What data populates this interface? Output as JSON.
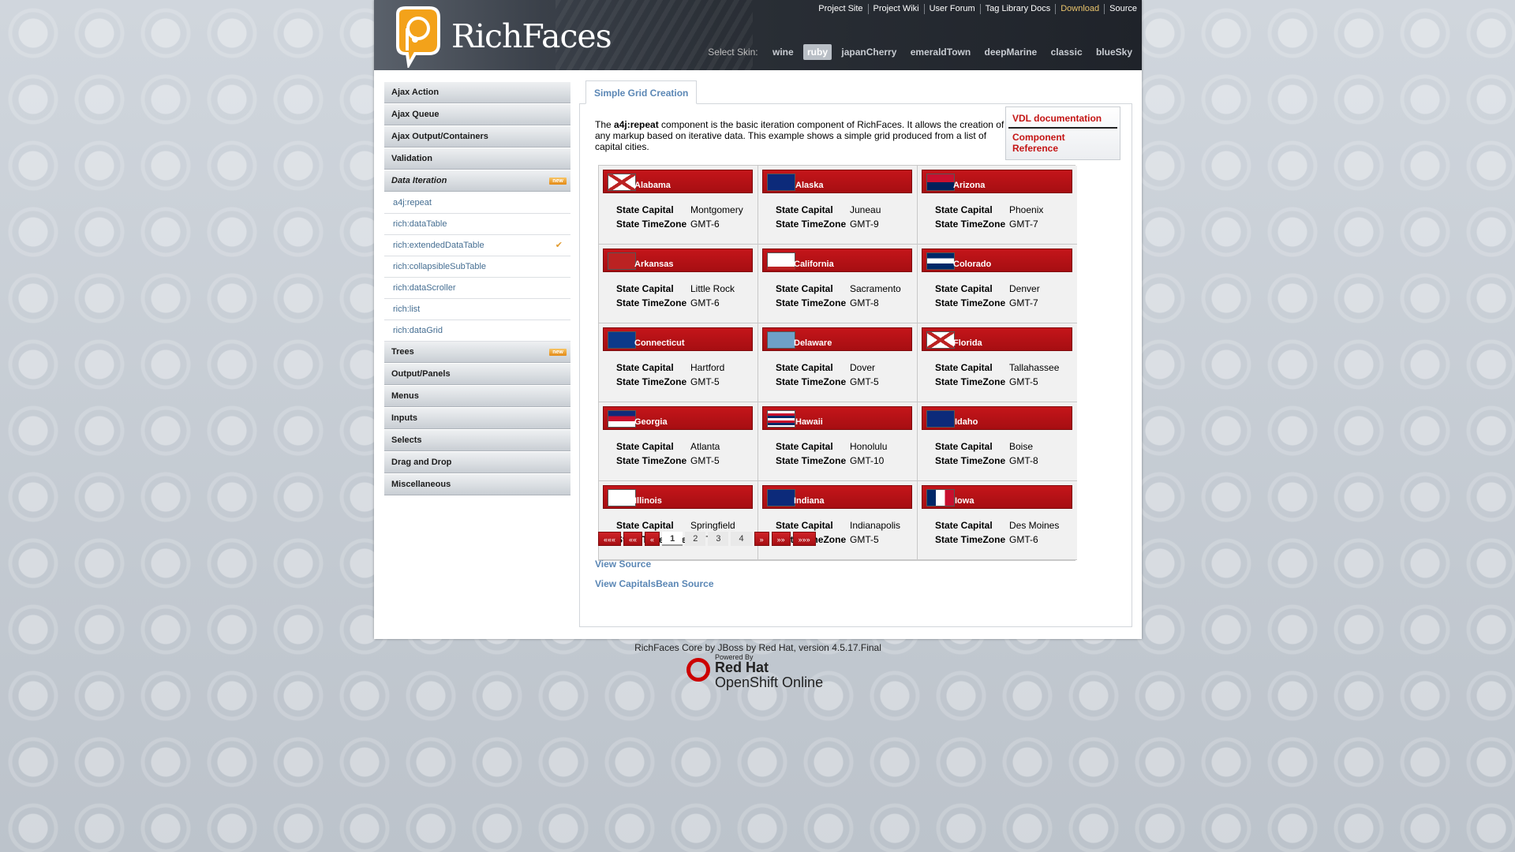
{
  "header": {
    "logo_text": "RichFaces",
    "top_links": [
      "Project Site",
      "Project Wiki",
      "User Forum",
      "Tag Library Docs",
      "Download",
      "Source"
    ],
    "skin_label": "Select Skin:",
    "skins": [
      "wine",
      "ruby",
      "japanCherry",
      "emeraldTown",
      "deepMarine",
      "classic",
      "blueSky"
    ],
    "active_skin": "ruby"
  },
  "sidebar": {
    "groups_before": [
      "Ajax Action",
      "Ajax Queue",
      "Ajax Output/Containers",
      "Validation"
    ],
    "open_group": "Data Iteration",
    "open_group_badge": "new",
    "open_items": [
      "a4j:repeat",
      "rich:dataTable",
      "rich:extendedDataTable",
      "rich:collapsibleSubTable",
      "rich:dataScroller",
      "rich:list",
      "rich:dataGrid"
    ],
    "checked_item": "rich:extendedDataTable",
    "trees_group": "Trees",
    "trees_badge": "new",
    "groups_after": [
      "Output/Panels",
      "Menus",
      "Inputs",
      "Selects",
      "Drag and Drop",
      "Miscellaneous"
    ]
  },
  "content": {
    "tab_label": "Simple Grid Creation",
    "desc_pre": "The ",
    "desc_bold": "a4j:repeat",
    "desc_post": " component is the basic iteration component of RichFaces. It allows the creation of any markup based on iterative data. This example shows a simple grid produced from a list of capital cities.",
    "doc_links": [
      "VDL documentation",
      "Component Reference"
    ],
    "capital_label": "State Capital",
    "timezone_label": "State TimeZone",
    "states": [
      {
        "name": "Alabama",
        "capital": "Montgomery",
        "tz": "GMT-6"
      },
      {
        "name": "Alaska",
        "capital": "Juneau",
        "tz": "GMT-9"
      },
      {
        "name": "Arizona",
        "capital": "Phoenix",
        "tz": "GMT-7"
      },
      {
        "name": "Arkansas",
        "capital": "Little Rock",
        "tz": "GMT-6"
      },
      {
        "name": "California",
        "capital": "Sacramento",
        "tz": "GMT-8"
      },
      {
        "name": "Colorado",
        "capital": "Denver",
        "tz": "GMT-7"
      },
      {
        "name": "Connecticut",
        "capital": "Hartford",
        "tz": "GMT-5"
      },
      {
        "name": "Delaware",
        "capital": "Dover",
        "tz": "GMT-5"
      },
      {
        "name": "Florida",
        "capital": "Tallahassee",
        "tz": "GMT-5"
      },
      {
        "name": "Georgia",
        "capital": "Atlanta",
        "tz": "GMT-5"
      },
      {
        "name": "Hawaii",
        "capital": "Honolulu",
        "tz": "GMT-10"
      },
      {
        "name": "Idaho",
        "capital": "Boise",
        "tz": "GMT-8"
      },
      {
        "name": "Illinois",
        "capital": "Springfield",
        "tz": "GMT-6"
      },
      {
        "name": "Indiana",
        "capital": "Indianapolis",
        "tz": "GMT-5"
      },
      {
        "name": "Iowa",
        "capital": "Des Moines",
        "tz": "GMT-6"
      }
    ],
    "pager": {
      "first": "«««",
      "fast_prev": "««",
      "prev": "«",
      "pages": [
        "1",
        "2",
        "3",
        "4"
      ],
      "current": "1",
      "next": "»",
      "fast_next": "»»",
      "last": "»»»"
    },
    "view_source": "View Source",
    "view_bean_source": "View CapitalsBean Source"
  },
  "footer": {
    "text": "RichFaces Core by JBoss by Red Hat, version 4.5.17.Final",
    "powered_by": "Powered By",
    "red_hat": "Red Hat",
    "openshift": "OpenShift Online"
  },
  "colors": {
    "header_bg": "#2a2f36",
    "cell_header_red": "#b31216",
    "link_blue": "#5b87b5",
    "doc_link_red": "#c41414",
    "download_gold": "#e8c36c"
  }
}
